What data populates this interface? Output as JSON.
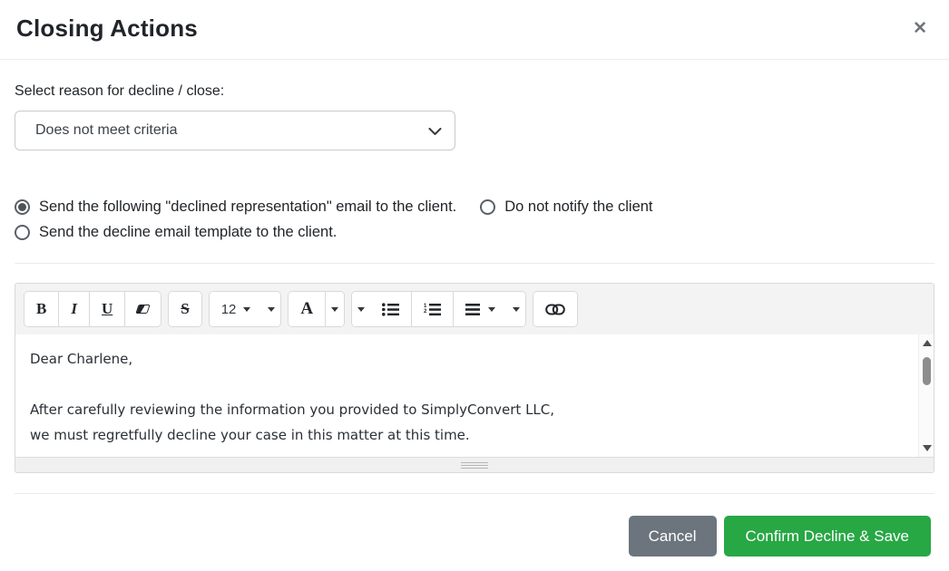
{
  "modal": {
    "title": "Closing Actions",
    "close_icon_glyph": "✕"
  },
  "reason": {
    "label": "Select reason for decline / close:",
    "selected_option": "Does not meet criteria"
  },
  "notify_options": {
    "send_following": {
      "label": "Send the following \"declined representation\" email to the client.",
      "selected": true
    },
    "do_not_notify": {
      "label": "Do not notify the client",
      "selected": false
    },
    "send_template": {
      "label": "Send the decline email template to the client.",
      "selected": false
    }
  },
  "editor": {
    "toolbar": {
      "bold": "B",
      "italic": "I",
      "underline": "U",
      "strikethrough": "S",
      "font_size": "12",
      "color_letter": "A",
      "icons": {
        "clear_format": "eraser-icon",
        "unordered_list": "bullet-list-icon",
        "ordered_list": "numbered-list-icon",
        "paragraph_align": "align-lines-icon",
        "link": "chain-link-icon"
      }
    },
    "content_lines": [
      "Dear Charlene,",
      "",
      "After carefully reviewing the information you provided to SimplyConvert LLC,",
      "we must regretfully decline your case in this matter at this time."
    ]
  },
  "footer": {
    "cancel_label": "Cancel",
    "confirm_label": "Confirm Decline & Save"
  },
  "colors": {
    "confirm_green": "#28a745",
    "cancel_gray": "#6c757d"
  }
}
